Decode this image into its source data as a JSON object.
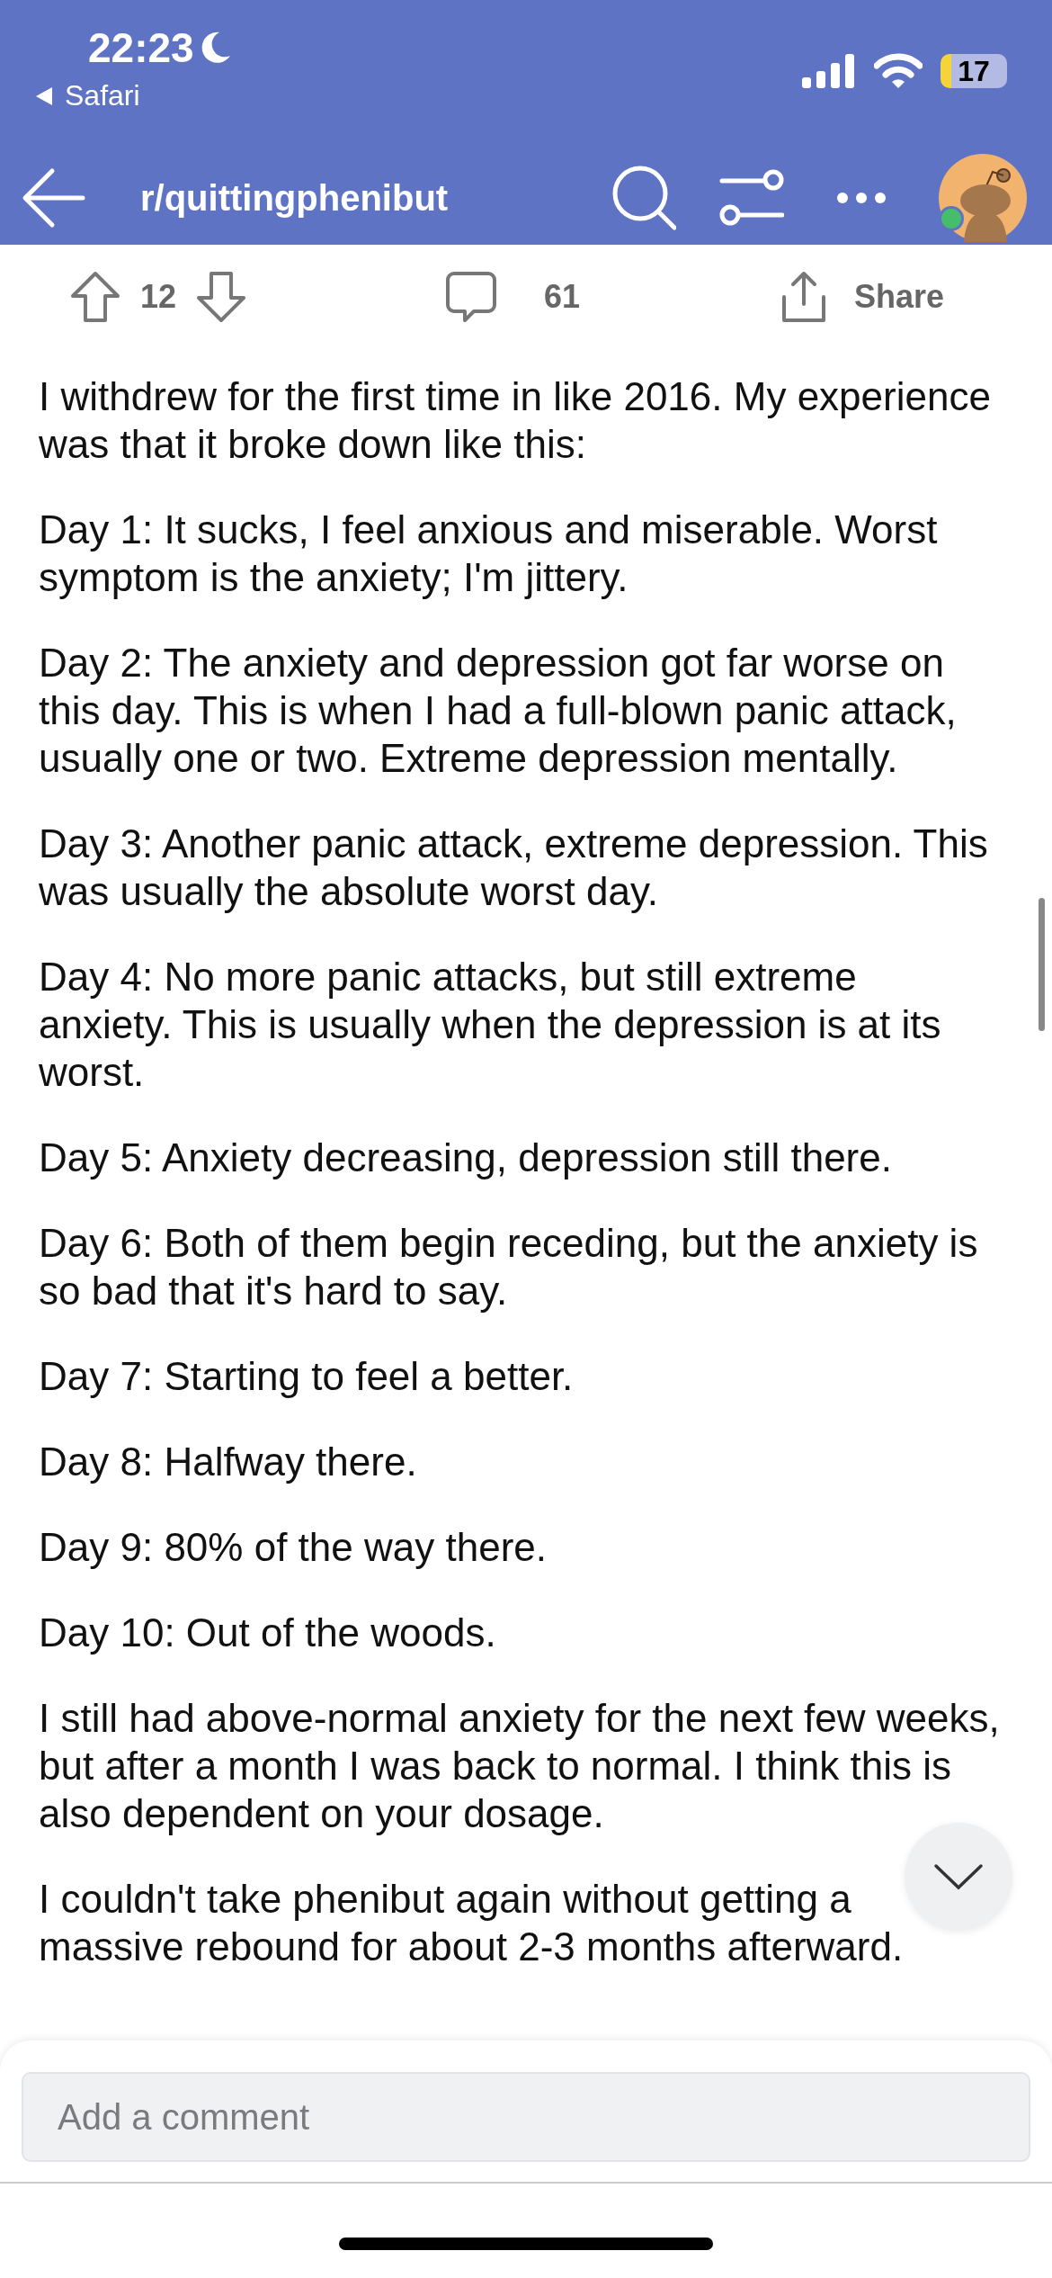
{
  "status_bar": {
    "time": "22:23",
    "back_app": "Safari",
    "battery": "17"
  },
  "header": {
    "title": "r/quittingphenibut",
    "online": true
  },
  "actions": {
    "upvotes": "12",
    "comments": "61",
    "share": "Share"
  },
  "paragraphs": [
    "I withdrew for the first time in like 2016. My experience was that it broke down like this:",
    "Day 1: It sucks, I feel anxious and miserable. Worst symptom is the anxiety; I'm jittery.",
    "Day 2: The anxiety and depression got far worse on this day. This is when I had a full-blown panic attack, usually one or two. Extreme depression mentally.",
    "Day 3: Another panic attack, extreme depression. This was usually the absolute worst day.",
    "Day 4: No more panic attacks, but still extreme anxiety. This is usually when the depression is at its worst.",
    "Day 5: Anxiety decreasing, depression still there.",
    "Day 6: Both of them begin receding, but the anxiety is so bad that it's hard to say.",
    "Day 7: Starting to feel a better.",
    "Day 8: Halfway there.",
    "Day 9: 80% of the way there.",
    "Day 10: Out of the woods.",
    "I still had above-normal anxiety for the next few weeks, but after a month I was back to normal. I think this is also dependent on your dosage.",
    "I couldn't take phenibut again without getting a massive rebound for about 2-3 months afterward."
  ],
  "comment_box": {
    "placeholder": "Add a comment"
  }
}
